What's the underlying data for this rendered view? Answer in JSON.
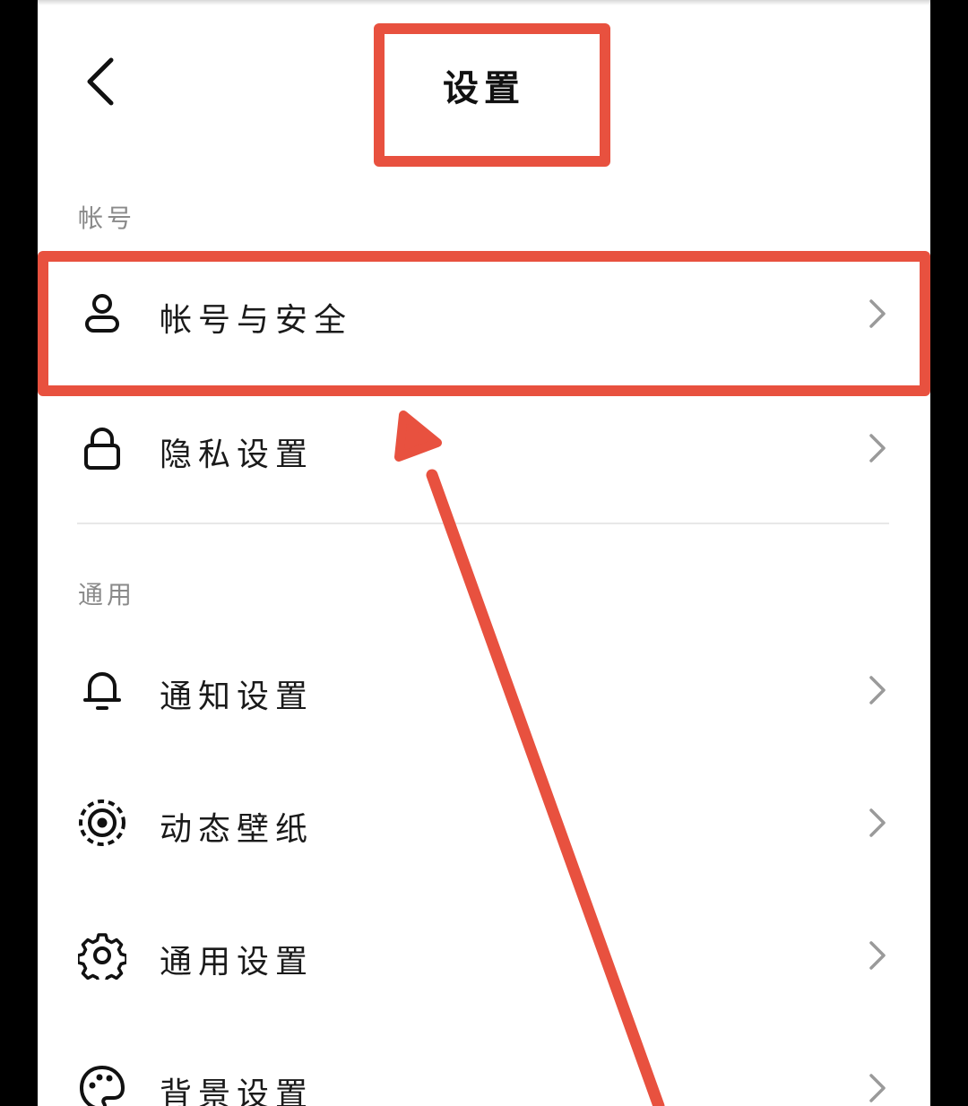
{
  "header": {
    "title": "设置",
    "back_icon": "chevron-left-icon"
  },
  "sections": [
    {
      "title": "帐号",
      "items": [
        {
          "label": "帐号与安全",
          "icon": "user-icon"
        },
        {
          "label": "隐私设置",
          "icon": "lock-icon"
        }
      ]
    },
    {
      "title": "通用",
      "items": [
        {
          "label": "通知设置",
          "icon": "bell-icon"
        },
        {
          "label": "动态壁纸",
          "icon": "dynamic-wallpaper-icon"
        },
        {
          "label": "通用设置",
          "icon": "gear-icon"
        },
        {
          "label": "背景设置",
          "icon": "palette-icon"
        }
      ]
    }
  ],
  "annotation": {
    "color": "#e8513f",
    "highlighted_items": [
      "设置",
      "帐号与安全"
    ]
  },
  "colors": {
    "background": "#ffffff",
    "text": "#1a1a1a",
    "section_header": "#8a8a8a",
    "chevron": "#9a9a9a"
  }
}
